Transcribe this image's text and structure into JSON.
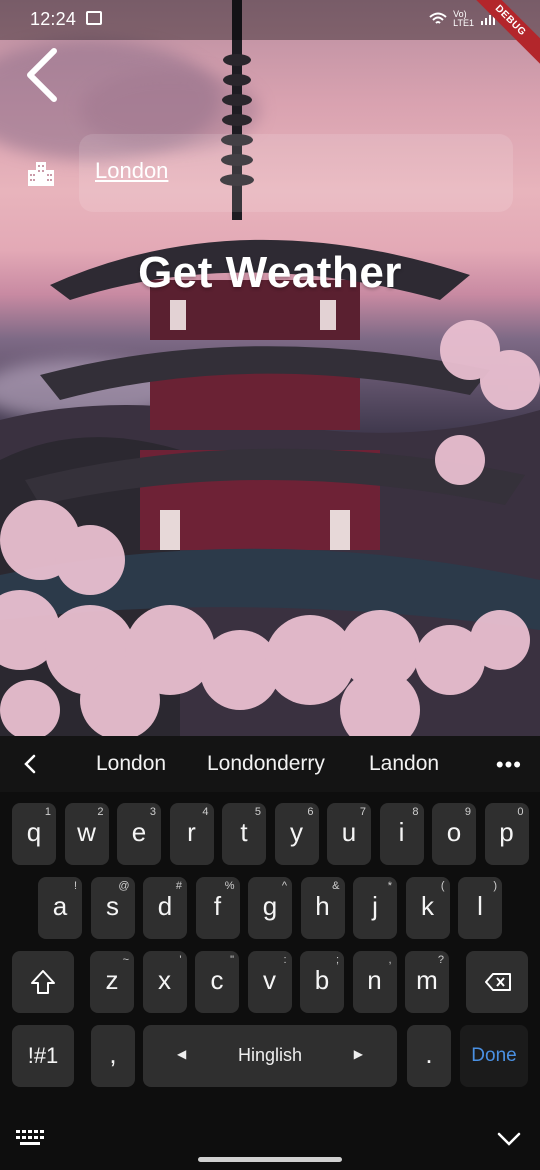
{
  "status_bar": {
    "time": "12:24",
    "network": "Vo)\nLTE1",
    "debug_label": "DEBUG"
  },
  "header": {
    "city_value": "London",
    "title": "Get Weather"
  },
  "keyboard": {
    "suggestions": [
      "London",
      "Londonderry",
      "Landon"
    ],
    "row1": [
      {
        "key": "q",
        "hint": "1"
      },
      {
        "key": "w",
        "hint": "2"
      },
      {
        "key": "e",
        "hint": "3"
      },
      {
        "key": "r",
        "hint": "4"
      },
      {
        "key": "t",
        "hint": "5"
      },
      {
        "key": "y",
        "hint": "6"
      },
      {
        "key": "u",
        "hint": "7"
      },
      {
        "key": "i",
        "hint": "8"
      },
      {
        "key": "o",
        "hint": "9"
      },
      {
        "key": "p",
        "hint": "0"
      }
    ],
    "row2": [
      {
        "key": "a",
        "hint": "!"
      },
      {
        "key": "s",
        "hint": "@"
      },
      {
        "key": "d",
        "hint": "#"
      },
      {
        "key": "f",
        "hint": "%"
      },
      {
        "key": "g",
        "hint": "^"
      },
      {
        "key": "h",
        "hint": "&"
      },
      {
        "key": "j",
        "hint": "*"
      },
      {
        "key": "k",
        "hint": "("
      },
      {
        "key": "l",
        "hint": ")"
      }
    ],
    "row3": [
      {
        "key": "z",
        "hint": "~"
      },
      {
        "key": "x",
        "hint": "'"
      },
      {
        "key": "c",
        "hint": "\""
      },
      {
        "key": "v",
        "hint": ":"
      },
      {
        "key": "b",
        "hint": ";"
      },
      {
        "key": "n",
        "hint": ","
      },
      {
        "key": "m",
        "hint": "?"
      }
    ],
    "symbols_key": "!#1",
    "comma_key": ",",
    "space_label": "Hinglish",
    "period_key": ".",
    "done_label": "Done"
  },
  "colors": {
    "done": "#4a90e2",
    "key_bg": "#2f2f2f",
    "keyboard_bg": "#0e0e0e"
  }
}
